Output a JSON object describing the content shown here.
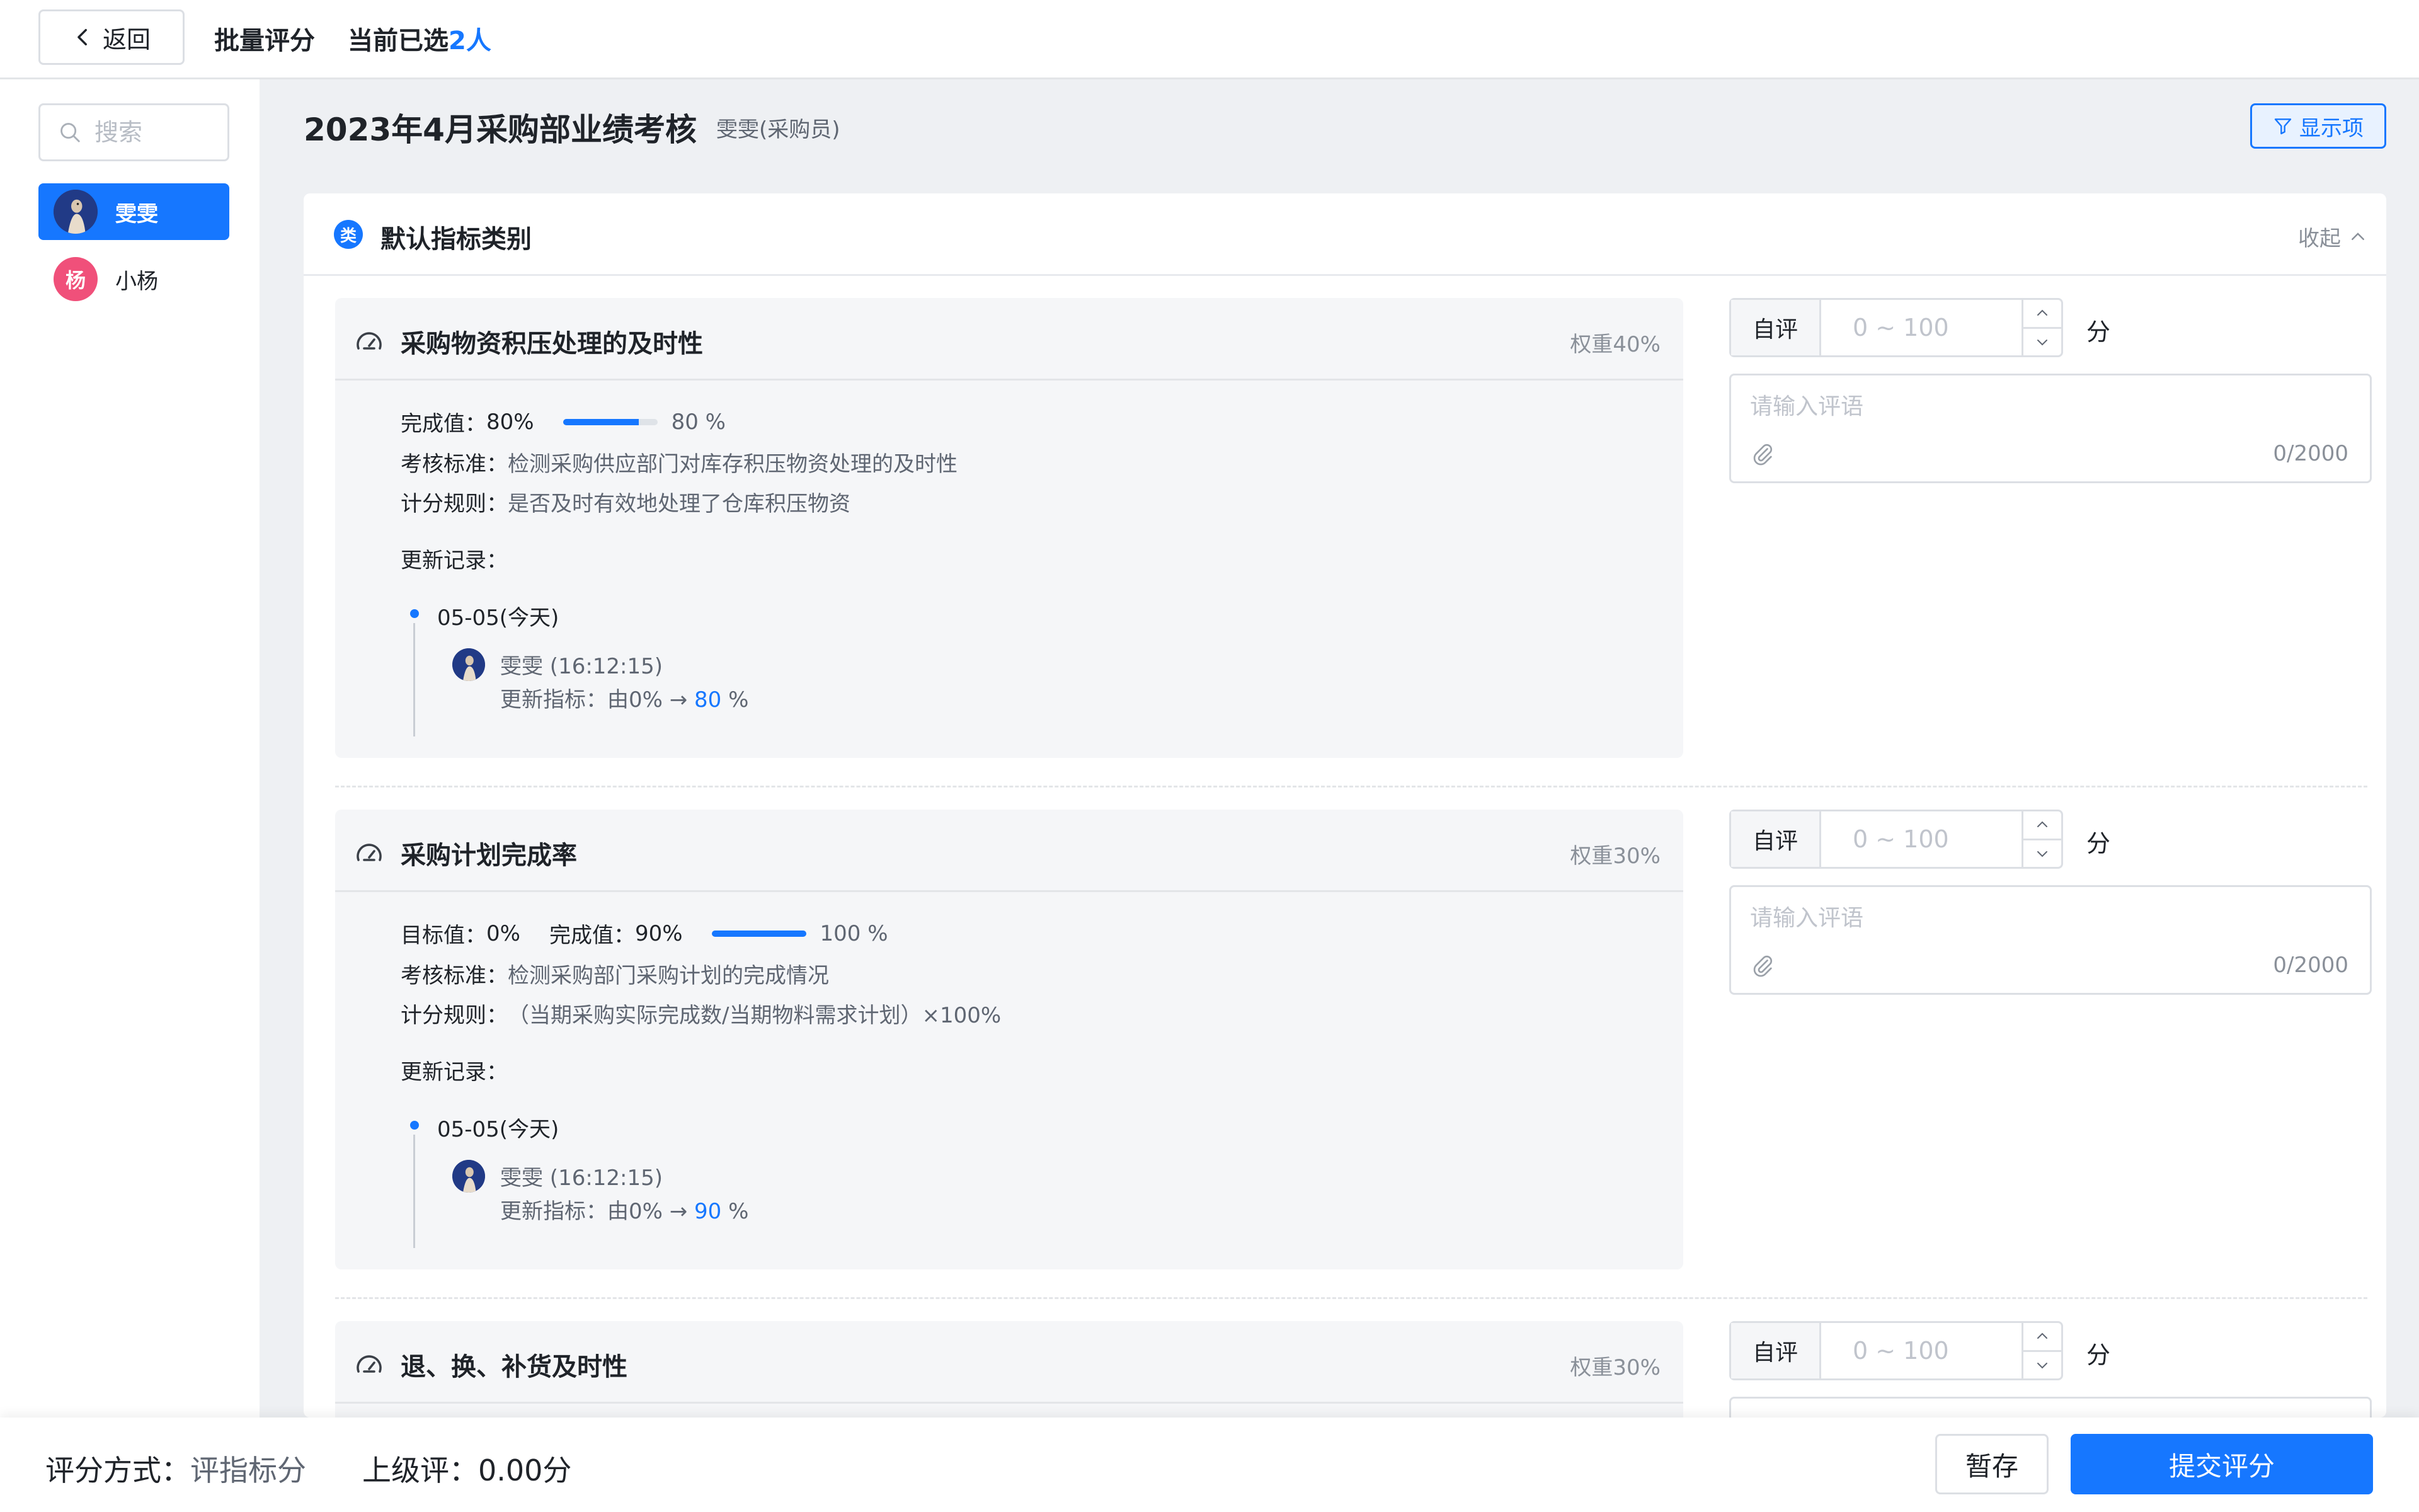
{
  "topbar": {
    "back_label": "返回",
    "batch_title": "批量评分",
    "selected_prefix": "当前已选",
    "selected_count": "2人"
  },
  "sidebar": {
    "search_placeholder": "搜索",
    "people": [
      {
        "name": "雯雯",
        "active": true
      },
      {
        "name": "小杨",
        "avatar_letter": "杨",
        "active": false
      }
    ]
  },
  "header": {
    "title": "2023年4月采购部业绩考核",
    "subtitle": "雯雯(采购员)",
    "display_button": "显示项"
  },
  "category": {
    "badge": "类",
    "title": "默认指标类别",
    "collapse_label": "收起"
  },
  "indicators": [
    {
      "title": "采购物资积压处理的及时性",
      "weight": "权重40%",
      "completion_label": "完成值：",
      "completion_value": "80%",
      "progress": 0.8,
      "progress_label": "80 %",
      "standard_label": "考核标准：",
      "standard": "检测采购供应部门对库存积压物资处理的及时性",
      "rule_label": "计分规则：",
      "rule": "是否及时有效地处理了仓库积压物资",
      "updates_label": "更新记录：",
      "update_date": "05-05(今天)",
      "update_user": "雯雯 (16:12:15)",
      "change_prefix": "更新指标：由0% →",
      "change_value": "80",
      "change_suffix": "%"
    },
    {
      "title": "采购计划完成率",
      "weight": "权重30%",
      "target_label": "目标值：",
      "target_value": "0%",
      "completion_label": "完成值：",
      "completion_value": "90%",
      "progress": 1.0,
      "progress_label": "100 %",
      "standard_label": "考核标准：",
      "standard": "检测采购部门采购计划的完成情况",
      "rule_label": "计分规则：",
      "rule": "（当期采购实际完成数/当期物料需求计划）×100%",
      "updates_label": "更新记录：",
      "update_date": "05-05(今天)",
      "update_user": "雯雯 (16:12:15)",
      "change_prefix": "更新指标：由0% →",
      "change_value": "90",
      "change_suffix": "%"
    },
    {
      "title": "退、换、补货及时性",
      "weight": "权重30%"
    }
  ],
  "scoring": {
    "self_label": "自评",
    "placeholder": "0 ~ 100",
    "unit": "分",
    "comment_placeholder": "请输入评语",
    "counter": "0/2000"
  },
  "footer": {
    "method_label": "评分方式：",
    "method_value": "评指标分",
    "superior_label": "上级评：",
    "superior_value": "0.00分",
    "save_label": "暂存",
    "submit_label": "提交评分"
  },
  "colors": {
    "accent": "#1677ff",
    "avatar_pink": "#f0507a",
    "avatar_navy": "#213a86"
  }
}
